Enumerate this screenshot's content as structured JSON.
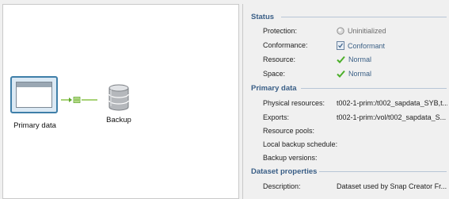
{
  "diagram": {
    "primary_label": "Primary data",
    "backup_label": "Backup"
  },
  "status": {
    "header": "Status",
    "protection_label": "Protection:",
    "protection_value": "Uninitialized",
    "conformance_label": "Conformance:",
    "conformance_value": "Conformant",
    "resource_label": "Resource:",
    "resource_value": "Normal",
    "space_label": "Space:",
    "space_value": "Normal"
  },
  "primary_data": {
    "header": "Primary data",
    "physical_label": "Physical resources:",
    "physical_value": "t002-1-prim:/t002_sapdata_SYB,t...",
    "exports_label": "Exports:",
    "exports_value": "t002-1-prim:/vol/t002_sapdata_S...",
    "pools_label": "Resource pools:",
    "pools_value": "",
    "schedule_label": "Local backup schedule:",
    "schedule_value": "",
    "versions_label": "Backup versions:",
    "versions_value": ""
  },
  "dataset_properties": {
    "header": "Dataset properties",
    "description_label": "Description:",
    "description_value": "Dataset used by Snap Creator Fr..."
  },
  "icons": {
    "protection": "uninitialized-circle-icon",
    "conformance": "conformant-shield-icon",
    "resource": "green-check-icon",
    "space": "green-check-icon",
    "window": "window-icon",
    "database": "database-icon",
    "connector": "replication-arrow-icon"
  },
  "colors": {
    "section_header": "#395e86",
    "selection_border": "#3f7fa9",
    "check_green": "#4caf2a",
    "connector_green": "#8bc34a"
  }
}
